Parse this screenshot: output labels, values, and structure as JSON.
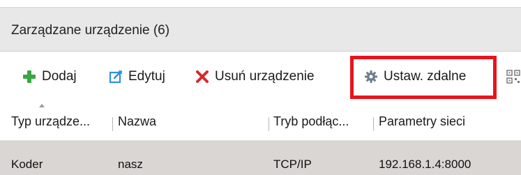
{
  "panel": {
    "title": "Zarządzane urządzenie (6)"
  },
  "toolbar": {
    "add_label": "Dodaj",
    "edit_label": "Edytuj",
    "delete_label": "Usuń urządzenie",
    "remote_settings_label": "Ustaw. zdalne",
    "icons": {
      "add": "plus-icon",
      "edit": "edit-icon",
      "delete": "delete-icon",
      "remote_settings": "gear-icon",
      "more": "qr-icon"
    }
  },
  "table": {
    "columns": [
      "Typ urządze...",
      "Nazwa",
      "Tryb podłąc...",
      "Parametry sieci"
    ],
    "rows": [
      {
        "type": "Koder",
        "name": "nasz",
        "connection_mode": "TCP/IP",
        "network_params": "192.168.1.4:8000"
      }
    ]
  },
  "colors": {
    "highlight": "#e8141c",
    "add_icon": "#3aa545",
    "edit_icon": "#2f8fdc",
    "delete_icon": "#d9262c",
    "gear_icon": "#6f7f90",
    "selected_row": "#d9d6d3"
  }
}
